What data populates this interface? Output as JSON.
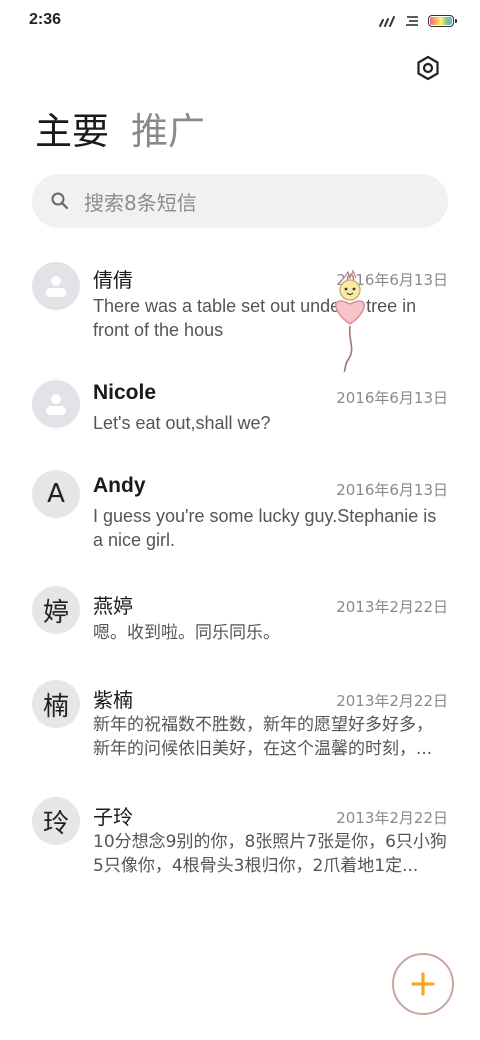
{
  "status_bar": {
    "time": "2:36"
  },
  "tabs": [
    {
      "label": "主要",
      "active": true
    },
    {
      "label": "推广",
      "active": false
    }
  ],
  "search": {
    "placeholder": "搜索8条短信"
  },
  "conversations": [
    {
      "name": "倩倩",
      "avatar": "person-icon",
      "date": "2016年6月13日",
      "preview": "There was a table set out under a tree in front of the hous"
    },
    {
      "name": "Nicole",
      "avatar": "person-icon",
      "date": "2016年6月13日",
      "preview": "Let's eat out,shall we?"
    },
    {
      "name": "Andy",
      "avatar_letter": "A",
      "date": "2016年6月13日",
      "preview": "I guess you're some lucky guy.Stephanie is a nice girl."
    },
    {
      "name": "燕婷",
      "avatar_letter": "婷",
      "date": "2013年2月22日",
      "preview": "嗯。收到啦。同乐同乐。"
    },
    {
      "name": "紫楠",
      "avatar_letter": "楠",
      "date": "2013年2月22日",
      "preview": "新年的祝福数不胜数，新年的愿望好多好多，新年的问候依旧美好，在这个温馨的时刻，..."
    },
    {
      "name": "子玲",
      "avatar_letter": "玲",
      "date": "2013年2月22日",
      "preview": "10分想念9别的你，8张照片7张是你，6只小狗5只像你，4根骨头3根归你，2爪着地1定..."
    }
  ],
  "colors": {
    "accent": "#f5a623",
    "fab_border": "#c9a79a"
  },
  "icons": {
    "settings": "settings-icon",
    "search": "search-icon",
    "fab": "plus-icon"
  }
}
